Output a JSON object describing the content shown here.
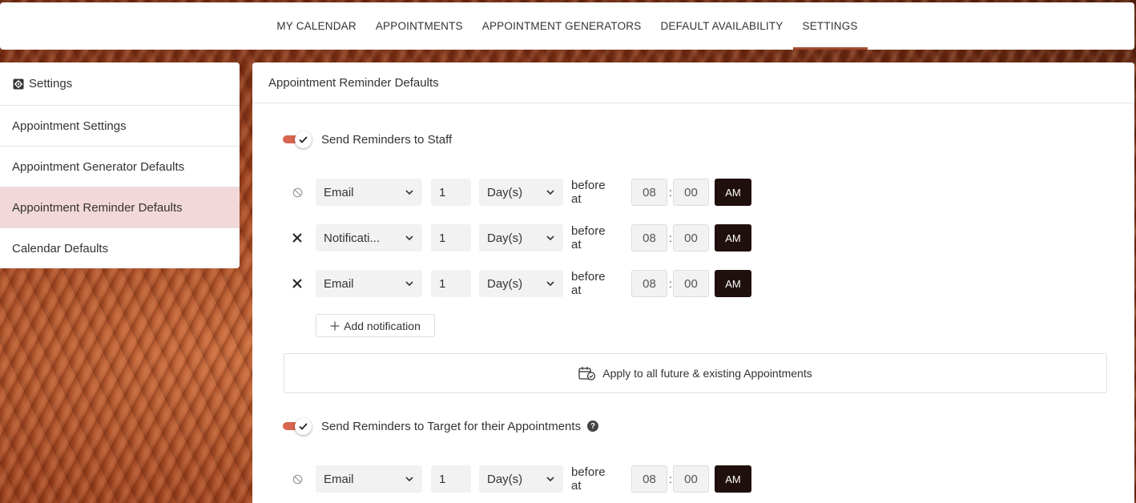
{
  "nav": {
    "items": [
      {
        "label": "MY CALENDAR"
      },
      {
        "label": "APPOINTMENTS"
      },
      {
        "label": "APPOINTMENT GENERATORS"
      },
      {
        "label": "DEFAULT AVAILABILITY"
      },
      {
        "label": "SETTINGS",
        "active": true
      }
    ]
  },
  "sidebar": {
    "title": "Settings",
    "icon": "gear-icon",
    "items": [
      {
        "label": "Appointment Settings"
      },
      {
        "label": "Appointment Generator Defaults"
      },
      {
        "label": "Appointment Reminder Defaults",
        "active": true
      },
      {
        "label": "Calendar Defaults"
      }
    ]
  },
  "panel": {
    "title": "Appointment Reminder Defaults",
    "staff": {
      "toggle_label": "Send Reminders to Staff",
      "enabled": true,
      "rows": [
        {
          "icon": "disabled-icon",
          "type": "Email",
          "amount": "1",
          "unit": "Day(s)",
          "before": "before at",
          "hour": "08",
          "minute": "00",
          "ampm": "AM"
        },
        {
          "icon": "close-icon",
          "type": "Notificati...",
          "amount": "1",
          "unit": "Day(s)",
          "before": "before at",
          "hour": "08",
          "minute": "00",
          "ampm": "AM"
        },
        {
          "icon": "close-icon",
          "type": "Email",
          "amount": "1",
          "unit": "Day(s)",
          "before": "before at",
          "hour": "08",
          "minute": "00",
          "ampm": "AM"
        }
      ],
      "add_label": "Add notification",
      "apply_label": "Apply to all future & existing Appointments"
    },
    "target": {
      "toggle_label": "Send Reminders to Target for their Appointments",
      "enabled": true,
      "help": "?",
      "rows": [
        {
          "icon": "disabled-icon",
          "type": "Email",
          "amount": "1",
          "unit": "Day(s)",
          "before": "before at",
          "hour": "08",
          "minute": "00",
          "ampm": "AM"
        }
      ]
    },
    "colon": ":"
  },
  "colors": {
    "accent": "#a34a2e",
    "toggle": "#d9644f",
    "active_sidebar": "#f2d8d8",
    "ampm_button": "#1f0f0d"
  }
}
